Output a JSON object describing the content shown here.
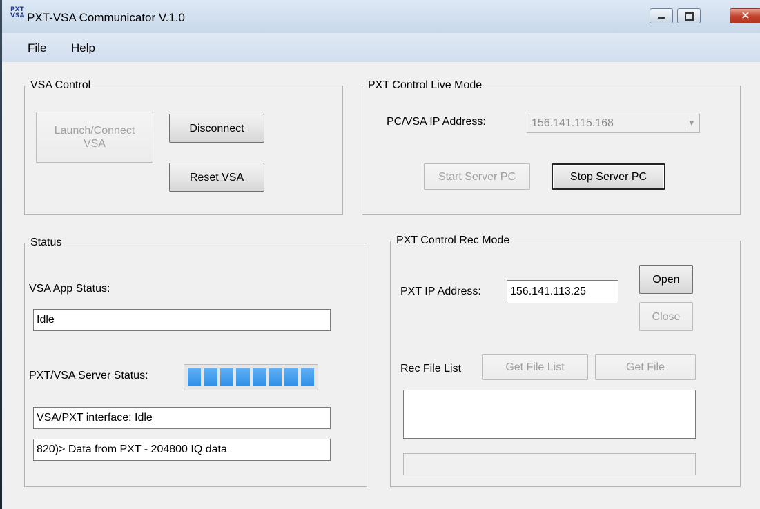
{
  "window": {
    "title": "PXT-VSA Communicator V.1.0",
    "icon_text": "PXT VSA",
    "close_glyph": "✕"
  },
  "menu": {
    "items": [
      "File",
      "Help"
    ]
  },
  "vsa_control": {
    "title": "VSA Control",
    "launch_label": "Launch/Connect\nVSA",
    "disconnect_label": "Disconnect",
    "reset_label": "Reset VSA"
  },
  "pxt_live": {
    "title": "PXT Control Live Mode",
    "ip_label": "PC/VSA IP Address:",
    "ip_value": "156.141.115.168",
    "start_label": "Start Server PC",
    "stop_label": "Stop Server PC"
  },
  "status": {
    "title": "Status",
    "app_status_label": "VSA App Status:",
    "app_status_value": "Idle",
    "server_status_label": "PXT/VSA Server Status:",
    "server_progress_segments": 8,
    "interface_value": "VSA/PXT interface: Idle",
    "log_value": "820)> Data from PXT - 204800 IQ data"
  },
  "pxt_rec": {
    "title": "PXT Control Rec Mode",
    "ip_label": "PXT IP Address:",
    "ip_value": "156.141.113.25",
    "open_label": "Open",
    "close_label": "Close",
    "file_list_label": "Rec File List",
    "get_file_list_label": "Get File List",
    "get_file_label": "Get File"
  },
  "colors": {
    "progress": "#2f8fe6",
    "close_button": "#c2412a"
  }
}
